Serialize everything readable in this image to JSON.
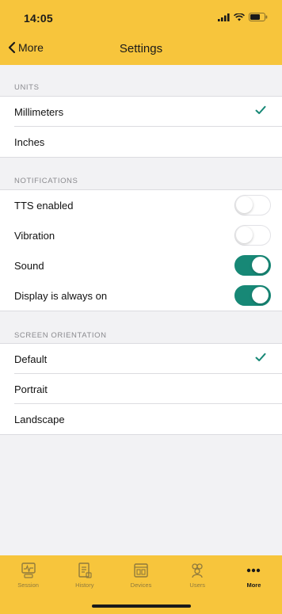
{
  "status_bar": {
    "time": "14:05"
  },
  "nav": {
    "back_label": "More",
    "title": "Settings"
  },
  "sections": {
    "units": {
      "header": "UNITS",
      "options": [
        {
          "label": "Millimeters",
          "selected": true
        },
        {
          "label": "Inches",
          "selected": false
        }
      ]
    },
    "notifications": {
      "header": "NOTIFICATIONS",
      "toggles": [
        {
          "label": "TTS enabled",
          "on": false
        },
        {
          "label": "Vibration",
          "on": false
        },
        {
          "label": "Sound",
          "on": true
        },
        {
          "label": "Display is always on",
          "on": true
        }
      ]
    },
    "orientation": {
      "header": "SCREEN ORIENTATION",
      "options": [
        {
          "label": "Default",
          "selected": true
        },
        {
          "label": "Portrait",
          "selected": false
        },
        {
          "label": "Landscape",
          "selected": false
        }
      ]
    }
  },
  "tab_bar": {
    "items": [
      {
        "label": "Session",
        "icon": "session-icon"
      },
      {
        "label": "History",
        "icon": "history-icon"
      },
      {
        "label": "Devices",
        "icon": "devices-icon"
      },
      {
        "label": "Users",
        "icon": "users-icon"
      },
      {
        "label": "More",
        "icon": "more-icon",
        "active": true
      }
    ]
  },
  "colors": {
    "header_bg": "#f7c53c",
    "accent": "#178876",
    "page_bg": "#f2f2f4",
    "tab_inactive": "#8f7a3d"
  }
}
